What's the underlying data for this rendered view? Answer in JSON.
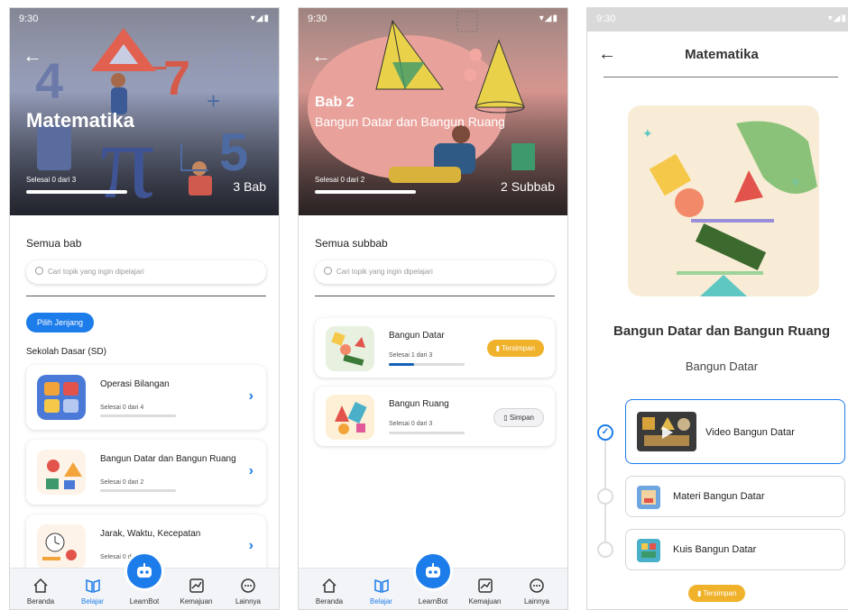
{
  "status": {
    "time": "9:30",
    "signal": "▾◢▮"
  },
  "colors": {
    "accent": "#1c7cea",
    "saved": "#f0b12b",
    "progress": "#1560b8"
  },
  "screen1": {
    "hero_title": "Matematika",
    "progress_label": "Selesai 0 dari 3",
    "count": "3 Bab",
    "section_title": "Semua bab",
    "search_placeholder": "Cari topik yang ingin dipelajari",
    "filter_button": "Pilih Jenjang",
    "level_label": "Sekolah Dasar (SD)",
    "chapters": [
      {
        "title": "Operasi Bilangan",
        "progress": "Selesai 0 dari 4",
        "done_fraction": 0
      },
      {
        "title": "Bangun Datar dan Bangun Ruang",
        "progress": "Selesai 0 dari 2",
        "done_fraction": 0
      },
      {
        "title": "Jarak, Waktu, Kecepatan",
        "progress": "Selesai 0 d",
        "done_fraction": 0
      }
    ]
  },
  "screen2": {
    "hero_bab": "Bab 2",
    "hero_sub": "Bangun Datar dan Bangun Ruang",
    "progress_label": "Selesai 0 dari 2",
    "count": "2 Subbab",
    "section_title": "Semua subbab",
    "search_placeholder": "Cari topik yang ingin dipelajari",
    "subchapters": [
      {
        "title": "Bangun Datar",
        "progress": "Selesai 1 dari 3",
        "done_fraction": 0.33,
        "save_label": "Tersimpan",
        "saved": true
      },
      {
        "title": "Bangun Ruang",
        "progress": "Selesai 0 dari 3",
        "done_fraction": 0,
        "save_label": "Simpan",
        "saved": false
      }
    ]
  },
  "screen3": {
    "title": "Matematika",
    "heading": "Bangun Datar dan Bangun Ruang",
    "subheading": "Bangun Datar",
    "items": [
      {
        "title": "Video Bangun Datar",
        "done": true
      },
      {
        "title": "Materi Bangun Datar",
        "done": false
      },
      {
        "title": "Kuis Bangun Datar",
        "done": false
      }
    ],
    "save_label": "Tersimpan"
  },
  "tabbar": {
    "tabs": [
      {
        "label": "Beranda",
        "icon": "home-icon"
      },
      {
        "label": "Belajar",
        "icon": "book-icon",
        "active": true
      },
      {
        "label": "LearnBot",
        "icon": "robot-icon"
      },
      {
        "label": "Kemajuan",
        "icon": "chart-icon"
      },
      {
        "label": "Lainnya",
        "icon": "more-icon"
      }
    ]
  }
}
